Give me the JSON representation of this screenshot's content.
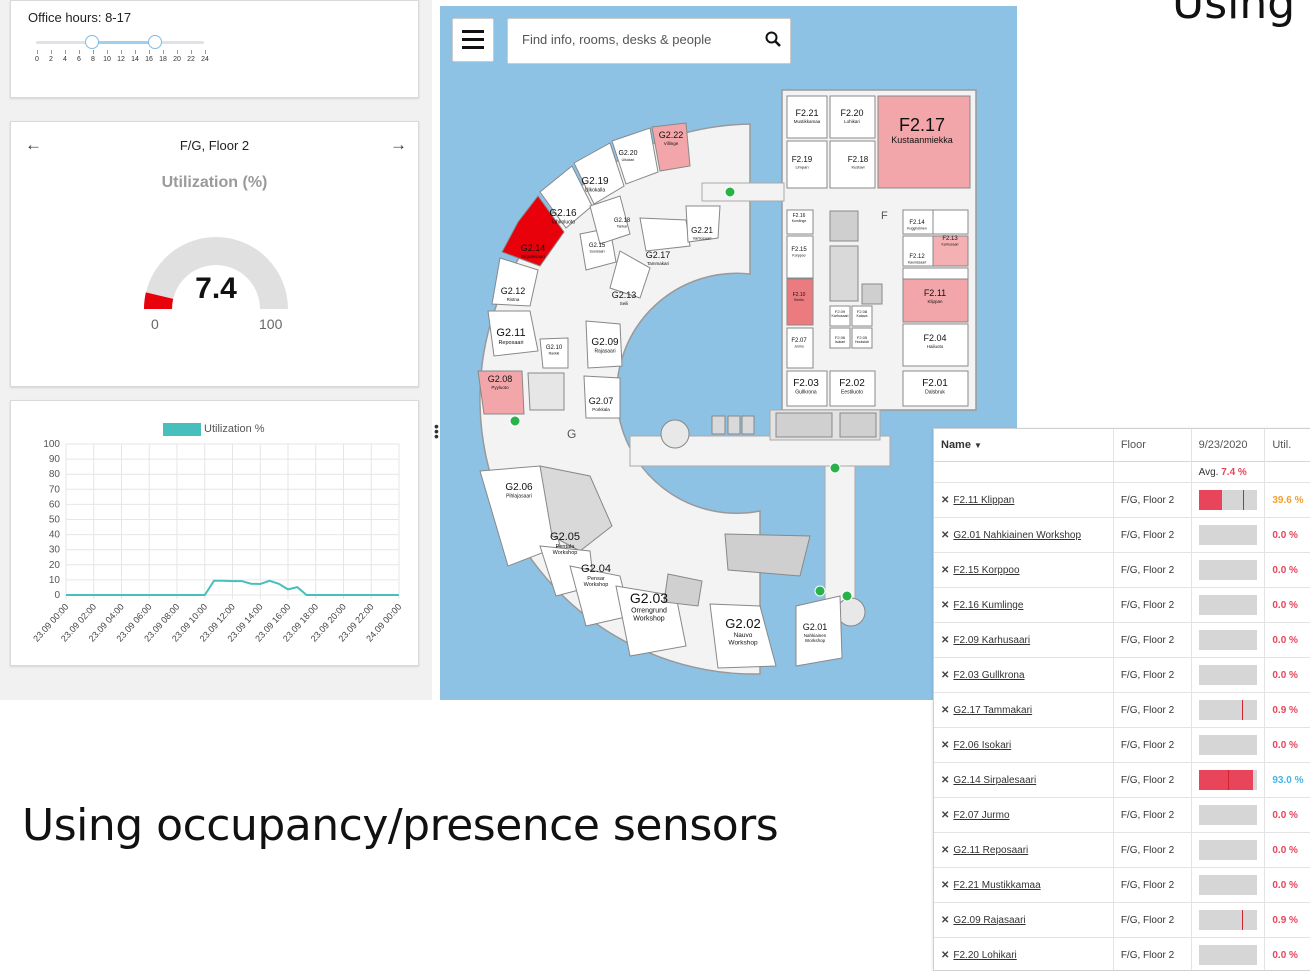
{
  "office_hours": {
    "label": "Office hours: 8-17",
    "start": 8,
    "end": 17,
    "ticks": [
      "0",
      "2",
      "4",
      "6",
      "8",
      "10",
      "12",
      "14",
      "16",
      "18",
      "20",
      "22",
      "24"
    ]
  },
  "floor_card": {
    "title": "F/G, Floor 2",
    "prev_icon": "arrow-left-icon",
    "next_icon": "arrow-right-icon",
    "utilization_title": "Utilization (%)",
    "gauge_value": "7.4",
    "gauge_min": "0",
    "gauge_max": "100",
    "gauge_color": "#e8000b"
  },
  "chart_data": {
    "type": "line",
    "series": [
      {
        "name": "Utilization %",
        "color": "#46bfbd",
        "values": [
          0,
          0,
          0,
          0,
          0,
          0,
          0,
          0,
          0,
          0,
          0,
          0,
          0,
          0,
          0,
          0,
          9.5,
          9.5,
          9.2,
          9.2,
          7.5,
          7.3,
          9.4,
          7.4,
          3.7,
          5.2,
          0,
          0,
          0,
          0,
          0,
          0,
          0,
          0,
          0,
          0,
          0
        ]
      }
    ],
    "x_tick_labels": [
      "23.09 00:00",
      "23.09 02:00",
      "23.09 04:00",
      "23.09 06:00",
      "23.09 08:00",
      "23.09 10:00",
      "23.09 12:00",
      "23.09 14:00",
      "23.09 16:00",
      "23.09 18:00",
      "23.09 20:00",
      "23.09 22:00",
      "24.09 00:00"
    ],
    "y_ticks": [
      "0",
      "10",
      "20",
      "30",
      "40",
      "50",
      "60",
      "70",
      "80",
      "90",
      "100"
    ],
    "ylim": [
      0,
      100
    ],
    "grid": true,
    "legend": "top"
  },
  "map": {
    "menu_icon": "hamburger-menu-icon",
    "search_placeholder": "Find info, rooms, desks & people",
    "search_icon": "search-icon",
    "water_color": "#8ec2e5",
    "letter_f": "F",
    "letter_g": "G",
    "rooms": [
      {
        "id": "F2.21",
        "sub": "Mustikkamaa"
      },
      {
        "id": "F2.20",
        "sub": "Lohikari"
      },
      {
        "id": "F2.17",
        "sub": "Kustaanmiekka"
      },
      {
        "id": "F2.19",
        "sub": "Limpan"
      },
      {
        "id": "F2.18",
        "sub": "Kustavi"
      },
      {
        "id": "F2.16",
        "sub": "Kumlinge"
      },
      {
        "id": "F2.15",
        "sub": "Korppoo"
      },
      {
        "id": "F2.14",
        "sub": "Kuggholmen"
      },
      {
        "id": "F2.13",
        "sub": "Karhusaari"
      },
      {
        "id": "F2.12",
        "sub": "Kaunissaari"
      },
      {
        "id": "F2.10",
        "sub": "Kimito"
      },
      {
        "id": "F2.11",
        "sub": "Klippan"
      },
      {
        "id": "F2.09",
        "sub": "Karhusaari"
      },
      {
        "id": "F2.08",
        "sub": "Katava"
      },
      {
        "id": "F2.07",
        "sub": "Jurmo"
      },
      {
        "id": "F2.06",
        "sub": "Isokari"
      },
      {
        "id": "F2.05",
        "sub": "Houtskär"
      },
      {
        "id": "F2.04",
        "sub": "Hailuoto"
      },
      {
        "id": "F2.03",
        "sub": "Gullkrona"
      },
      {
        "id": "F2.02",
        "sub": "Eestiluoto"
      },
      {
        "id": "F2.01",
        "sub": "Dalsbruk"
      },
      {
        "id": "G2.22",
        "sub": "Villinge"
      },
      {
        "id": "G2.20",
        "sub": "Ulkokari"
      },
      {
        "id": "G2.19",
        "sub": "Ulkokalla"
      },
      {
        "id": "G2.16",
        "sub": "Tahkoluoto"
      },
      {
        "id": "G2.18",
        "sub": "Tankar"
      },
      {
        "id": "G2.21",
        "sub": "Vartiosaari"
      },
      {
        "id": "G2.14",
        "sub": "Sirpalesaari"
      },
      {
        "id": "G2.15",
        "sub": "Suursaari"
      },
      {
        "id": "G2.17",
        "sub": "Tammakari"
      },
      {
        "id": "G2.12",
        "sub": "Ristna"
      },
      {
        "id": "G2.13",
        "sub": "Seili"
      },
      {
        "id": "G2.11",
        "sub": "Reposaari"
      },
      {
        "id": "G2.10",
        "sub": "Rankki"
      },
      {
        "id": "G2.09",
        "sub": "Rajasaari"
      },
      {
        "id": "G2.08",
        "sub": "Pyyluoto"
      },
      {
        "id": "G2.07",
        "sub": "Porkkala"
      },
      {
        "id": "G2.06",
        "sub": "Pihlajasaari"
      },
      {
        "id": "G2.05",
        "sub": "Pentala Workshop"
      },
      {
        "id": "G2.04",
        "sub": "Pensar Workshop"
      },
      {
        "id": "G2.03",
        "sub": "Orrengrund Workshop"
      },
      {
        "id": "G2.02",
        "sub": "Nauvo Workshop"
      },
      {
        "id": "G2.01",
        "sub": "Nahkiainen Workshop"
      }
    ]
  },
  "headline": "Using occupancy/presence sensors",
  "corner_text": "Using",
  "table": {
    "headers": [
      "Name",
      "Floor",
      "9/23/2020",
      "Util."
    ],
    "sort_icon": "caret-down-icon",
    "avg_label": "Avg.",
    "avg_value": "7.4 %",
    "avg_color": "#e8455a",
    "rows": [
      {
        "name": "F2.11 Klippan",
        "floor": "F/G, Floor 2",
        "fill": 0.39,
        "marker": 0.76,
        "util": "39.6 %",
        "color": "#f0a030"
      },
      {
        "name": "G2.01 Nahkiainen Workshop",
        "floor": "F/G, Floor 2",
        "fill": 0,
        "marker": null,
        "util": "0.0 %",
        "color": "#e8455a"
      },
      {
        "name": "F2.15 Korppoo",
        "floor": "F/G, Floor 2",
        "fill": 0,
        "marker": null,
        "util": "0.0 %",
        "color": "#e8455a"
      },
      {
        "name": "F2.16 Kumlinge",
        "floor": "F/G, Floor 2",
        "fill": 0,
        "marker": null,
        "util": "0.0 %",
        "color": "#e8455a"
      },
      {
        "name": "F2.09 Karhusaari",
        "floor": "F/G, Floor 2",
        "fill": 0,
        "marker": null,
        "util": "0.0 %",
        "color": "#e8455a"
      },
      {
        "name": "F2.03 Gullkrona",
        "floor": "F/G, Floor 2",
        "fill": 0,
        "marker": null,
        "util": "0.0 %",
        "color": "#e8455a"
      },
      {
        "name": "G2.17 Tammakari",
        "floor": "F/G, Floor 2",
        "fill": 0,
        "marker": 0.74,
        "util": "0.9 %",
        "color": "#e8455a"
      },
      {
        "name": "F2.06 Isokari",
        "floor": "F/G, Floor 2",
        "fill": 0,
        "marker": null,
        "util": "0.0 %",
        "color": "#e8455a"
      },
      {
        "name": "G2.14 Sirpalesaari",
        "floor": "F/G, Floor 2",
        "fill": 0.93,
        "marker": 0.5,
        "util": "93.0 %",
        "color": "#45b6e6"
      },
      {
        "name": "F2.07 Jurmo",
        "floor": "F/G, Floor 2",
        "fill": 0,
        "marker": null,
        "util": "0.0 %",
        "color": "#e8455a"
      },
      {
        "name": "G2.11 Reposaari",
        "floor": "F/G, Floor 2",
        "fill": 0,
        "marker": null,
        "util": "0.0 %",
        "color": "#e8455a"
      },
      {
        "name": "F2.21 Mustikkamaa",
        "floor": "F/G, Floor 2",
        "fill": 0,
        "marker": null,
        "util": "0.0 %",
        "color": "#e8455a"
      },
      {
        "name": "G2.09 Rajasaari",
        "floor": "F/G, Floor 2",
        "fill": 0,
        "marker": 0.74,
        "util": "0.9 %",
        "color": "#e8455a"
      },
      {
        "name": "F2.20 Lohikari",
        "floor": "F/G, Floor 2",
        "fill": 0,
        "marker": null,
        "util": "0.0 %",
        "color": "#e8455a"
      }
    ]
  }
}
